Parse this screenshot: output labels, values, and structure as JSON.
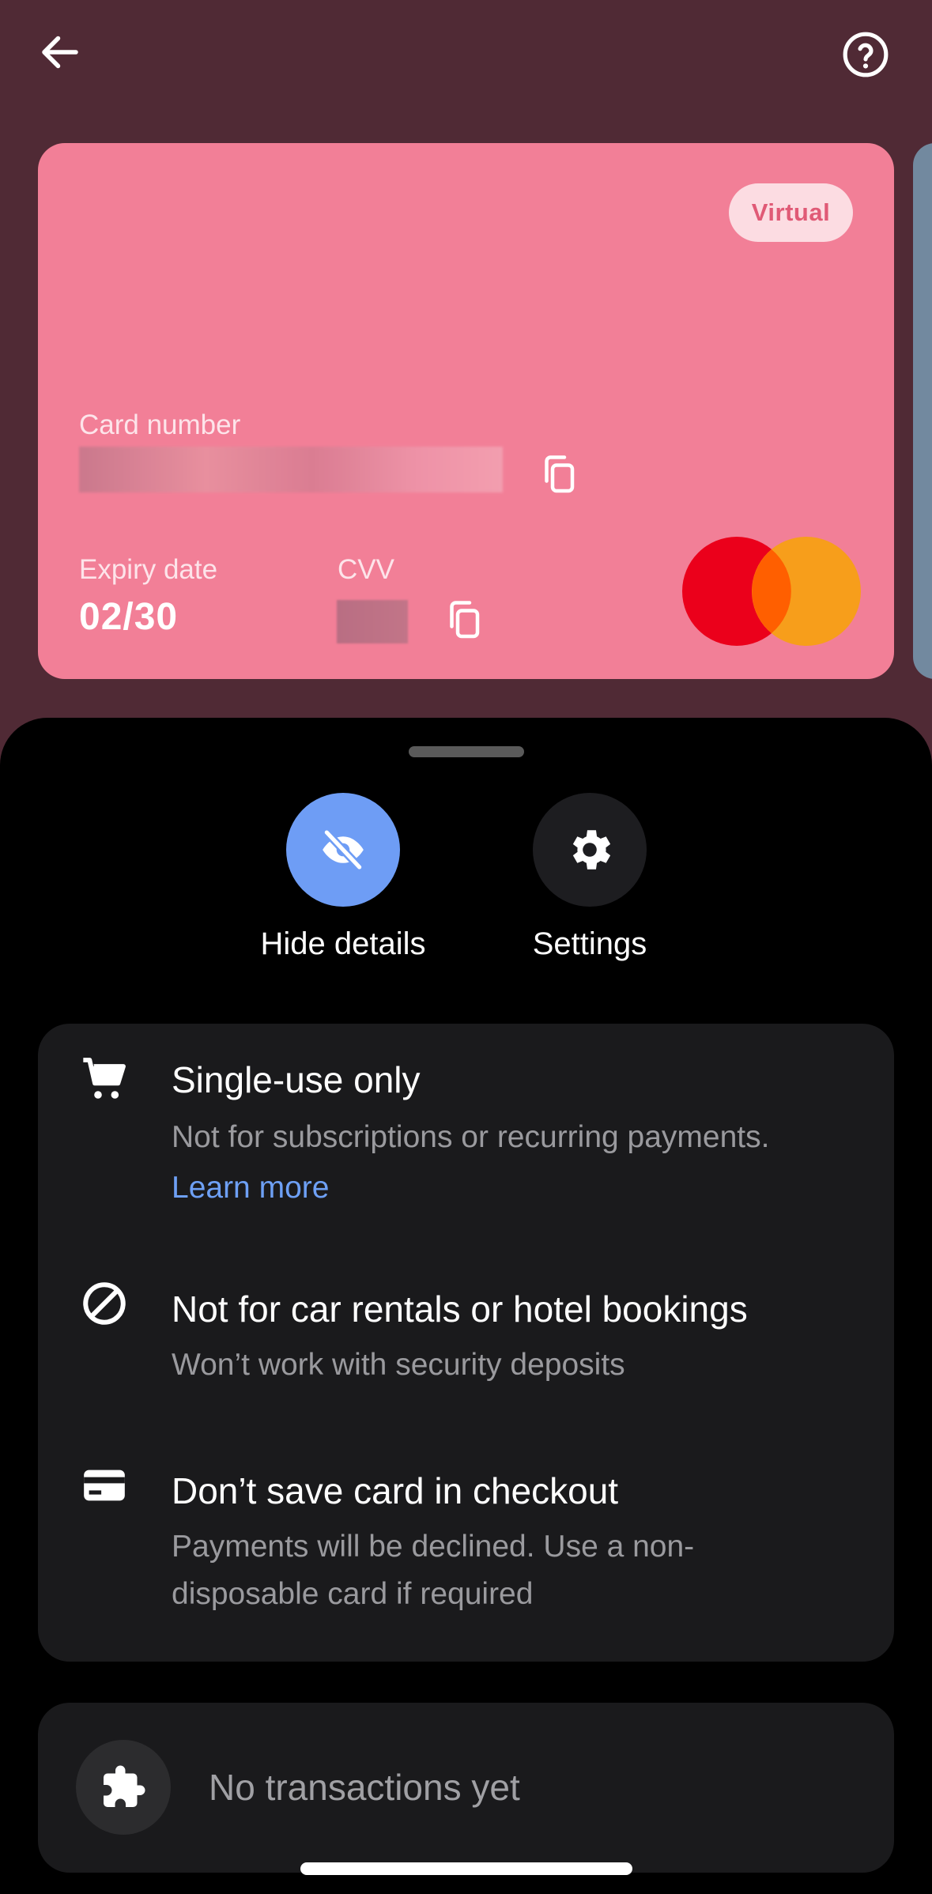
{
  "header": {
    "back_icon": "arrow-left-icon",
    "help_icon": "question-circle-icon"
  },
  "card": {
    "badge": "Virtual",
    "card_number_label": "Card number",
    "expiry_label": "Expiry date",
    "expiry_value": "02/30",
    "cvv_label": "CVV",
    "network": "Mastercard",
    "color": "#f27f97"
  },
  "actions": {
    "hide_details": {
      "label": "Hide details",
      "icon": "eye-off-icon",
      "color": "#6e9df5"
    },
    "settings": {
      "label": "Settings",
      "icon": "gear-icon"
    }
  },
  "restrictions": [
    {
      "icon": "cart-icon",
      "title": "Single-use only",
      "description": "Not for subscriptions or recurring payments.",
      "link": "Learn more"
    },
    {
      "icon": "block-icon",
      "title": "Not for car rentals or hotel bookings",
      "description": "Won’t work with security deposits"
    },
    {
      "icon": "card-icon",
      "title": "Don’t save card in checkout",
      "description": "Payments will be declined. Use a non-disposable card if required"
    }
  ],
  "transactions": {
    "icon": "puzzle-icon",
    "empty_text": "No transactions yet"
  }
}
